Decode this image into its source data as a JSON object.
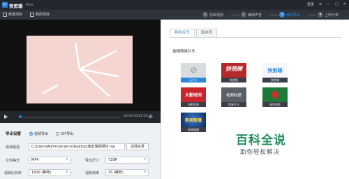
{
  "app": {
    "title": "快剪辑",
    "beta": "Beta"
  },
  "titlebar": {
    "login": "登录",
    "menu": "≡",
    "minimize": "—",
    "maximize": "□",
    "close": "✕"
  },
  "toolbar": {
    "new_project": "新建项目",
    "my_projects": "我的项目",
    "steps": [
      {
        "num": "1",
        "label": "剪辑视频",
        "active": false
      },
      {
        "num": "2",
        "label": "编辑声音",
        "active": false
      },
      {
        "num": "3",
        "label": "保存导出",
        "active": true
      },
      {
        "num": "4",
        "label": "上传分享",
        "active": false
      }
    ]
  },
  "player": {
    "timecode": "00:00.00/02:50.44",
    "progress": 0.0
  },
  "settings": {
    "title": "导出设置",
    "format_options": [
      {
        "label": "视频导出",
        "selected": true
      },
      {
        "label": "GIF导出",
        "selected": false
      }
    ],
    "save_path_label": "保存路径",
    "save_path_value": "C:\\Users\\Administrator\\Desktop\\快剪辑视频\\8.mp",
    "browse_label": "选择目录",
    "file_format_label": "文件格式",
    "file_format_value": "MP4",
    "export_size_label": "导出尺寸",
    "export_size_value": "720P",
    "video_bitrate_label": "视频比特率",
    "video_bitrate_value": "1500 (推荐)",
    "video_fps_label": "视频帧率",
    "video_fps_value": "25 (推荐)"
  },
  "right_panel": {
    "tabs": [
      {
        "label": "特效片头",
        "active": true
      },
      {
        "label": "加水印",
        "active": false
      }
    ],
    "section_label": "选择特效片头",
    "tiles": [
      {
        "thumb_text": "⊘",
        "label": "无片头",
        "selected": true
      },
      {
        "thumb_text": "快视频",
        "label": "快视频",
        "selected": false
      },
      {
        "thumb_text": "快剪辑",
        "label": "快剪辑",
        "selected": false
      },
      {
        "thumb_text": "大影时间",
        "label": "光影时间",
        "selected": false
      },
      {
        "thumb_text": "视频标题",
        "label": "简易片头",
        "selected": false
      },
      {
        "thumb_text": "",
        "label": "绿色剪影",
        "selected": false
      },
      {
        "thumb_text": "新闻联播",
        "label": "新闻联播",
        "selected": false
      }
    ]
  },
  "watermark": {
    "title": "百科全说",
    "subtitle": "助你轻松解决"
  },
  "colors": {
    "accent": "#2a86e0",
    "titlebar": "#23272e",
    "toolbar": "#2f343b"
  }
}
